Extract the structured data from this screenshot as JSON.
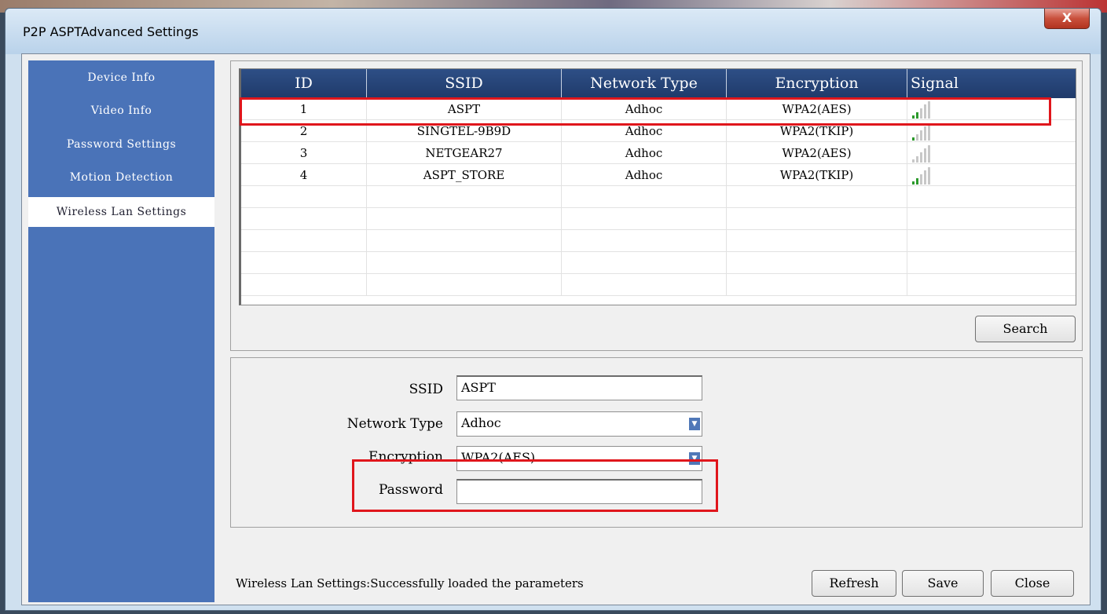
{
  "window": {
    "title": "P2P ASPTAdvanced Settings",
    "close_glyph": "X"
  },
  "sidebar": {
    "items": [
      {
        "label": "Device Info"
      },
      {
        "label": "Video Info"
      },
      {
        "label": "Password Settings"
      },
      {
        "label": "Motion Detection"
      },
      {
        "label": "Wireless Lan Settings",
        "active": true
      }
    ]
  },
  "table": {
    "headers": [
      "ID",
      "SSID",
      "Network Type",
      "Encryption",
      "Signal"
    ],
    "rows": [
      {
        "id": "1",
        "ssid": "ASPT",
        "type": "Adhoc",
        "enc": "WPA2(AES)",
        "signal_bars": 2
      },
      {
        "id": "2",
        "ssid": "SINGTEL-9B9D",
        "type": "Adhoc",
        "enc": "WPA2(TKIP)",
        "signal_bars": 1
      },
      {
        "id": "3",
        "ssid": "NETGEAR27",
        "type": "Adhoc",
        "enc": "WPA2(AES)",
        "signal_bars": 0
      },
      {
        "id": "4",
        "ssid": "ASPT_STORE",
        "type": "Adhoc",
        "enc": "WPA2(TKIP)",
        "signal_bars": 2
      }
    ],
    "highlighted_row": 1
  },
  "buttons": {
    "search": "Search",
    "refresh": "Refresh",
    "save": "Save",
    "close": "Close"
  },
  "form": {
    "ssid_label": "SSID",
    "ssid_value": "ASPT",
    "type_label": "Network Type",
    "type_value": "Adhoc",
    "enc_label": "Encryption",
    "enc_value": "WPA2(AES)",
    "password_label": "Password",
    "password_value": ""
  },
  "status": "Wireless Lan Settings:Successfully loaded the parameters",
  "colors": {
    "sidebar": "#4a73b8",
    "header": "#1f3a6a",
    "signal_on": "#2c9a2c",
    "signal_off": "#c8c8c8",
    "highlight": "#e0161c"
  }
}
